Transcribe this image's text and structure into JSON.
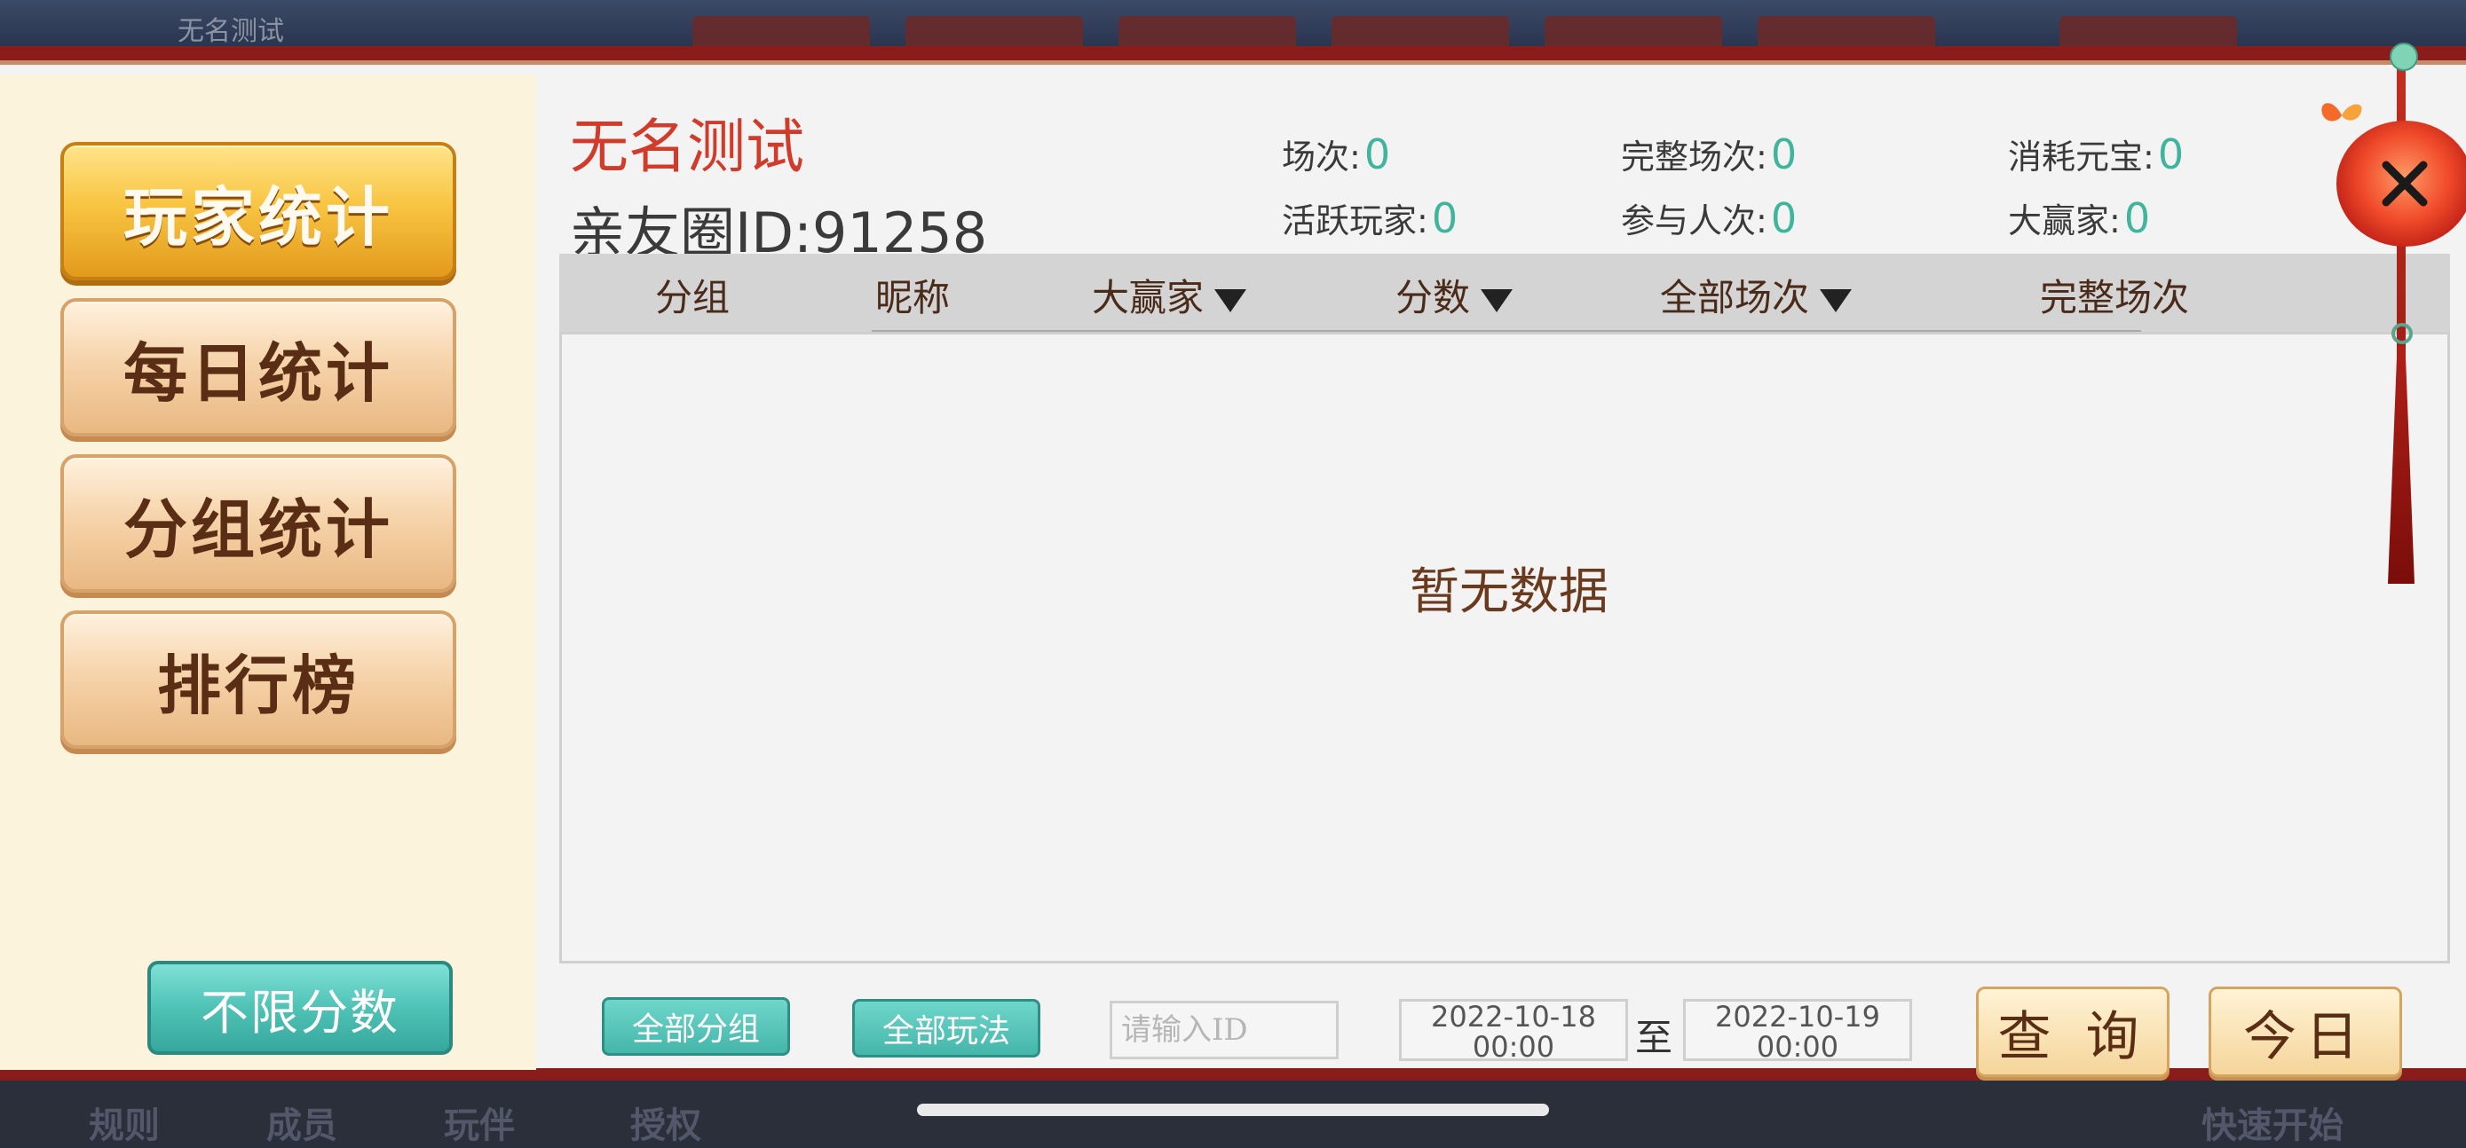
{
  "background": {
    "top_text": "无名测试",
    "bottom_texts": [
      "规则",
      "成员",
      "玩伴",
      "授权",
      "快速开始"
    ]
  },
  "sidebar": {
    "items": [
      {
        "label": "玩家统计",
        "active": true
      },
      {
        "label": "每日统计",
        "active": false
      },
      {
        "label": "分组统计",
        "active": false
      },
      {
        "label": "排行榜",
        "active": false
      }
    ],
    "filter_button": "不限分数"
  },
  "header": {
    "club_name": "无名测试",
    "club_id_label": "亲友圈ID:",
    "club_id": "91258"
  },
  "stats": [
    {
      "label": "场次:",
      "value": "0"
    },
    {
      "label": "完整场次:",
      "value": "0"
    },
    {
      "label": "消耗元宝:",
      "value": "0"
    },
    {
      "label": "活跃玩家:",
      "value": "0"
    },
    {
      "label": "参与人次:",
      "value": "0"
    },
    {
      "label": "大赢家:",
      "value": "0"
    }
  ],
  "table": {
    "columns": [
      {
        "label": "分组",
        "sortable": false
      },
      {
        "label": "昵称",
        "sortable": false
      },
      {
        "label": "大赢家",
        "sortable": true
      },
      {
        "label": "分数",
        "sortable": true
      },
      {
        "label": "全部场次",
        "sortable": true
      },
      {
        "label": "完整场次",
        "sortable": false
      }
    ],
    "rows": [],
    "empty_text": "暂无数据"
  },
  "controls": {
    "group_button": "全部分组",
    "mode_button": "全部玩法",
    "id_placeholder": "请输入ID",
    "start_date": "2022-10-18",
    "start_time": "00:00",
    "date_separator": "至",
    "end_date": "2022-10-19",
    "end_time": "00:00",
    "query_button": "查 询",
    "today_button": "今日"
  },
  "colors": {
    "accent_red": "#d23a2a",
    "stat_value": "#3fb59e",
    "frame_red": "#8a1c1c",
    "sidebar_bg": "#fcf3dc"
  },
  "icons": {
    "close": "close-icon",
    "sort": "sort-down-icon"
  }
}
